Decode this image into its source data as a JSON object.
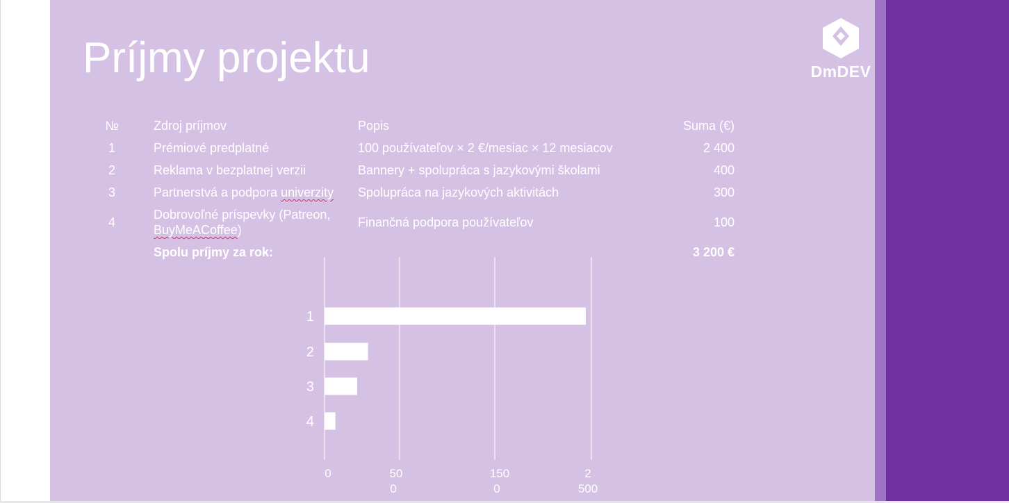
{
  "slide": {
    "title": "Príjmy projektu",
    "logo_text": "DmDEV",
    "colors": {
      "background": "#d5c1e4",
      "accent_light": "#9d72c4",
      "accent_dark": "#7030a0",
      "text": "#ffffff"
    }
  },
  "table": {
    "headers": {
      "num": "№",
      "source": "Zdroj príjmov",
      "description": "Popis",
      "amount": "Suma (€)"
    },
    "rows": [
      {
        "num": "1",
        "source": "Prémiové predplatné",
        "description": "100 používateľov × 2 €/mesiac × 12 mesiacov",
        "amount": "2 400"
      },
      {
        "num": "2",
        "source": "Reklama v bezplatnej verzii",
        "description": "Bannery + spolupráca s jazykovými školami",
        "amount": "400"
      },
      {
        "num": "3",
        "source_a": "Partnerstvá a podpora ",
        "source_b": "univerzity",
        "description": "Spolupráca na jazykových aktivitách",
        "amount": "300"
      },
      {
        "num": "4",
        "source_line1": "Dobrovoľné príspevky (Patreon,",
        "source_line2a": "BuyMeACoffee",
        "source_line2b": ")",
        "description": "Finančná podpora používateľov",
        "amount": "100"
      }
    ],
    "total": {
      "label": "Spolu príjmy za rok:",
      "amount": "3 200 €"
    }
  },
  "chart_data": {
    "type": "bar",
    "orientation": "horizontal",
    "categories": [
      "1",
      "2",
      "3",
      "4"
    ],
    "values": [
      2400,
      400,
      300,
      100
    ],
    "x_tick_labels": [
      {
        "line1": "0",
        "line2": ""
      },
      {
        "line1": "50",
        "line2": "0"
      },
      {
        "line1": "150",
        "line2": "0"
      },
      {
        "line1": "2",
        "line2": "500"
      }
    ],
    "grid": true,
    "bar_color": "#ffffff",
    "title": "",
    "xlabel": "",
    "ylabel": ""
  }
}
